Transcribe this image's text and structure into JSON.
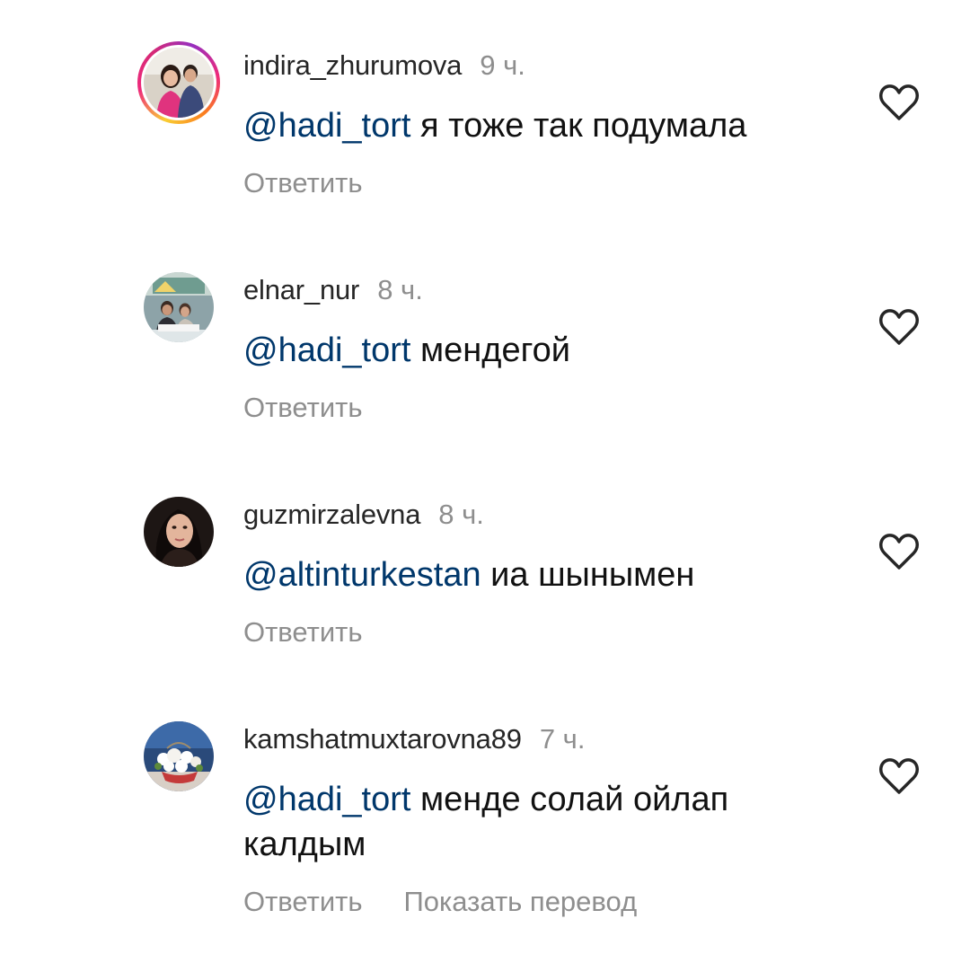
{
  "comments": [
    {
      "username": "indira_zhurumova",
      "time": "9 ч.",
      "mention": "@hadi_tort",
      "text": " я тоже так подумала",
      "reply_label": "Ответить",
      "has_story": true
    },
    {
      "username": "elnar_nur",
      "time": "8 ч.",
      "mention": "@hadi_tort",
      "text": " мендегой",
      "reply_label": "Ответить",
      "has_story": false
    },
    {
      "username": "guzmirzalevna",
      "time": "8 ч.",
      "mention": "@altinturkestan",
      "text": " иа шынымен",
      "reply_label": "Ответить",
      "has_story": false
    },
    {
      "username": "kamshatmuxtarovna89",
      "time": "7 ч.",
      "mention": "@hadi_tort",
      "text": " менде солай ойлап калдым",
      "reply_label": "Ответить",
      "translate_label": "Показать перевод",
      "has_story": false
    }
  ],
  "icons": {
    "like": "heart-icon"
  },
  "colors": {
    "mention": "#00376b",
    "secondary_text": "#8e8e8e",
    "username": "#262626"
  }
}
